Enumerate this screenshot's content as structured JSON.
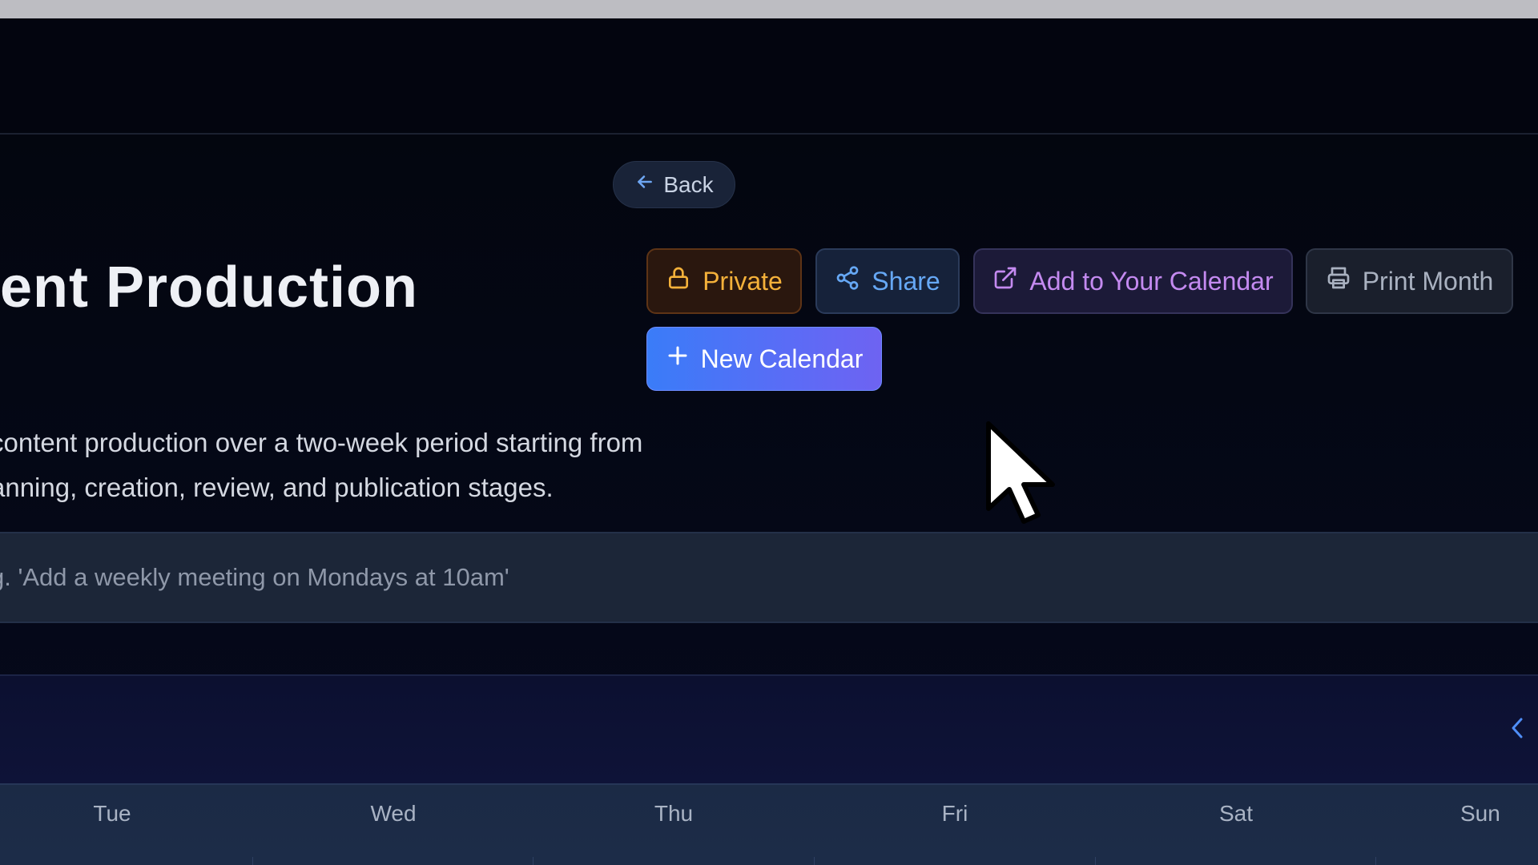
{
  "header": {
    "back_label": "Back"
  },
  "page": {
    "title": "ntent Production",
    "description_line1": "content production over a two-week period starting from",
    "description_line2": "anning, creation, review, and publication stages."
  },
  "actions": {
    "private_label": "Private",
    "share_label": "Share",
    "add_to_calendar_label": "Add to Your Calendar",
    "print_label": "Print Month",
    "new_calendar_label": "New Calendar"
  },
  "prompt": {
    "placeholder": "g. 'Add a weekly meeting on Mondays at 10am'"
  },
  "calendar": {
    "weekdays": [
      "Tue",
      "Wed",
      "Thu",
      "Fri",
      "Sat",
      "Sun"
    ]
  },
  "icons": {
    "back": "arrow-left-icon",
    "private": "lock-icon",
    "share": "share-icon",
    "add_to_calendar": "external-link-icon",
    "print": "printer-icon",
    "new_calendar": "plus-icon",
    "prev_month": "chevron-left-icon"
  },
  "colors": {
    "private": "#f4b13a",
    "share": "#66a8f5",
    "add_to_calendar": "#c48af0",
    "print": "#a9b1c0",
    "new_calendar_start": "#3a7cf8",
    "new_calendar_end": "#6e63f2"
  }
}
